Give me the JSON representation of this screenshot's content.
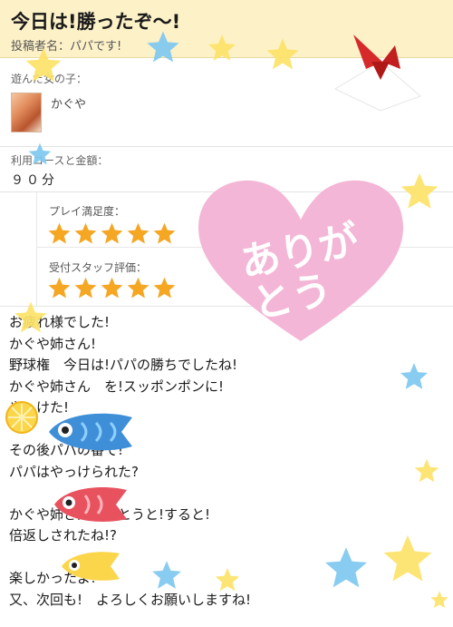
{
  "header": {
    "title": "今日は!勝ったぞ〜!",
    "poster": "投稿者名：パパです!"
  },
  "companion": {
    "label": "遊んだ女の子：",
    "name": "かぐや"
  },
  "course": {
    "label": "利用コースと金額：",
    "value": "９０分"
  },
  "ratings": {
    "play": {
      "label": "プレイ満足度：",
      "stars": 5,
      "max": 5
    },
    "staff": {
      "label": "受付スタッフ評価：",
      "stars": 5,
      "max": 5
    }
  },
  "message": {
    "lines": [
      "お疲れ様でした!",
      "かぐや姉さん!",
      "野球権　今日は!パパの勝ちでしたね!",
      "かぐや姉さん　を!スッポンポンに!",
      "やっけた!",
      "",
      "その後パパの番で!",
      "パパはやっけられた?",
      "",
      "かぐや姉さんが勝とうと!すると!",
      "倍返しされたね!?",
      "",
      "楽しかったよ!",
      "又、次回も!　よろしくお願いしますね!"
    ]
  },
  "stamp": {
    "text_line1": "ありが",
    "text_line2": "とう"
  },
  "colors": {
    "header_bg": "#fdf1c8",
    "star_orange": "#f5a623",
    "heart_pink": "#f4b6d6",
    "star_blue": "#7fc8f0",
    "star_yellow": "#fde36a"
  }
}
